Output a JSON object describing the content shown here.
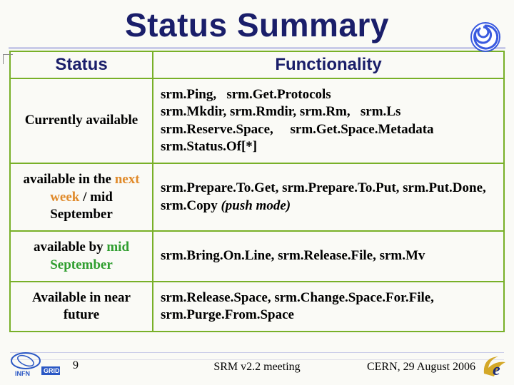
{
  "title": "Status Summary",
  "headers": {
    "status": "Status",
    "func": "Functionality"
  },
  "rows": [
    {
      "status_plain": "Currently available",
      "status_orange": "",
      "status_green": "",
      "status_tail": "",
      "func_html": "srm.Ping,   srm.Get.Protocols\nsrm.Mkdir, srm.Rmdir, srm.Rm,   srm.Ls\nsrm.Reserve.Space,     srm.Get.Space.Metadata\nsrm.Status.Of[*]",
      "func_italic": ""
    },
    {
      "status_plain": "available in the ",
      "status_orange": "next week",
      "status_green": "",
      "status_tail": " / mid September",
      "func_html": "srm.Prepare.To.Get, srm.Prepare.To.Put, srm.Put.Done, srm.Copy ",
      "func_italic": "(push mode)"
    },
    {
      "status_plain": "available by ",
      "status_orange": "",
      "status_green": "mid September",
      "status_tail": "",
      "func_html": "srm.Bring.On.Line, srm.Release.File, srm.Mv",
      "func_italic": ""
    },
    {
      "status_plain": "Available in near future",
      "status_orange": "",
      "status_green": "",
      "status_tail": "",
      "func_html": "srm.Release.Space, srm.Change.Space.For.File, srm.Purge.From.Space",
      "func_italic": ""
    }
  ],
  "footer": {
    "page": "9",
    "center": "SRM v2.2 meeting",
    "right": "CERN,  29 August 2006"
  },
  "logos": {
    "spiral": "spiral-logo",
    "infn": "INFN GRID",
    "egee": "e"
  }
}
